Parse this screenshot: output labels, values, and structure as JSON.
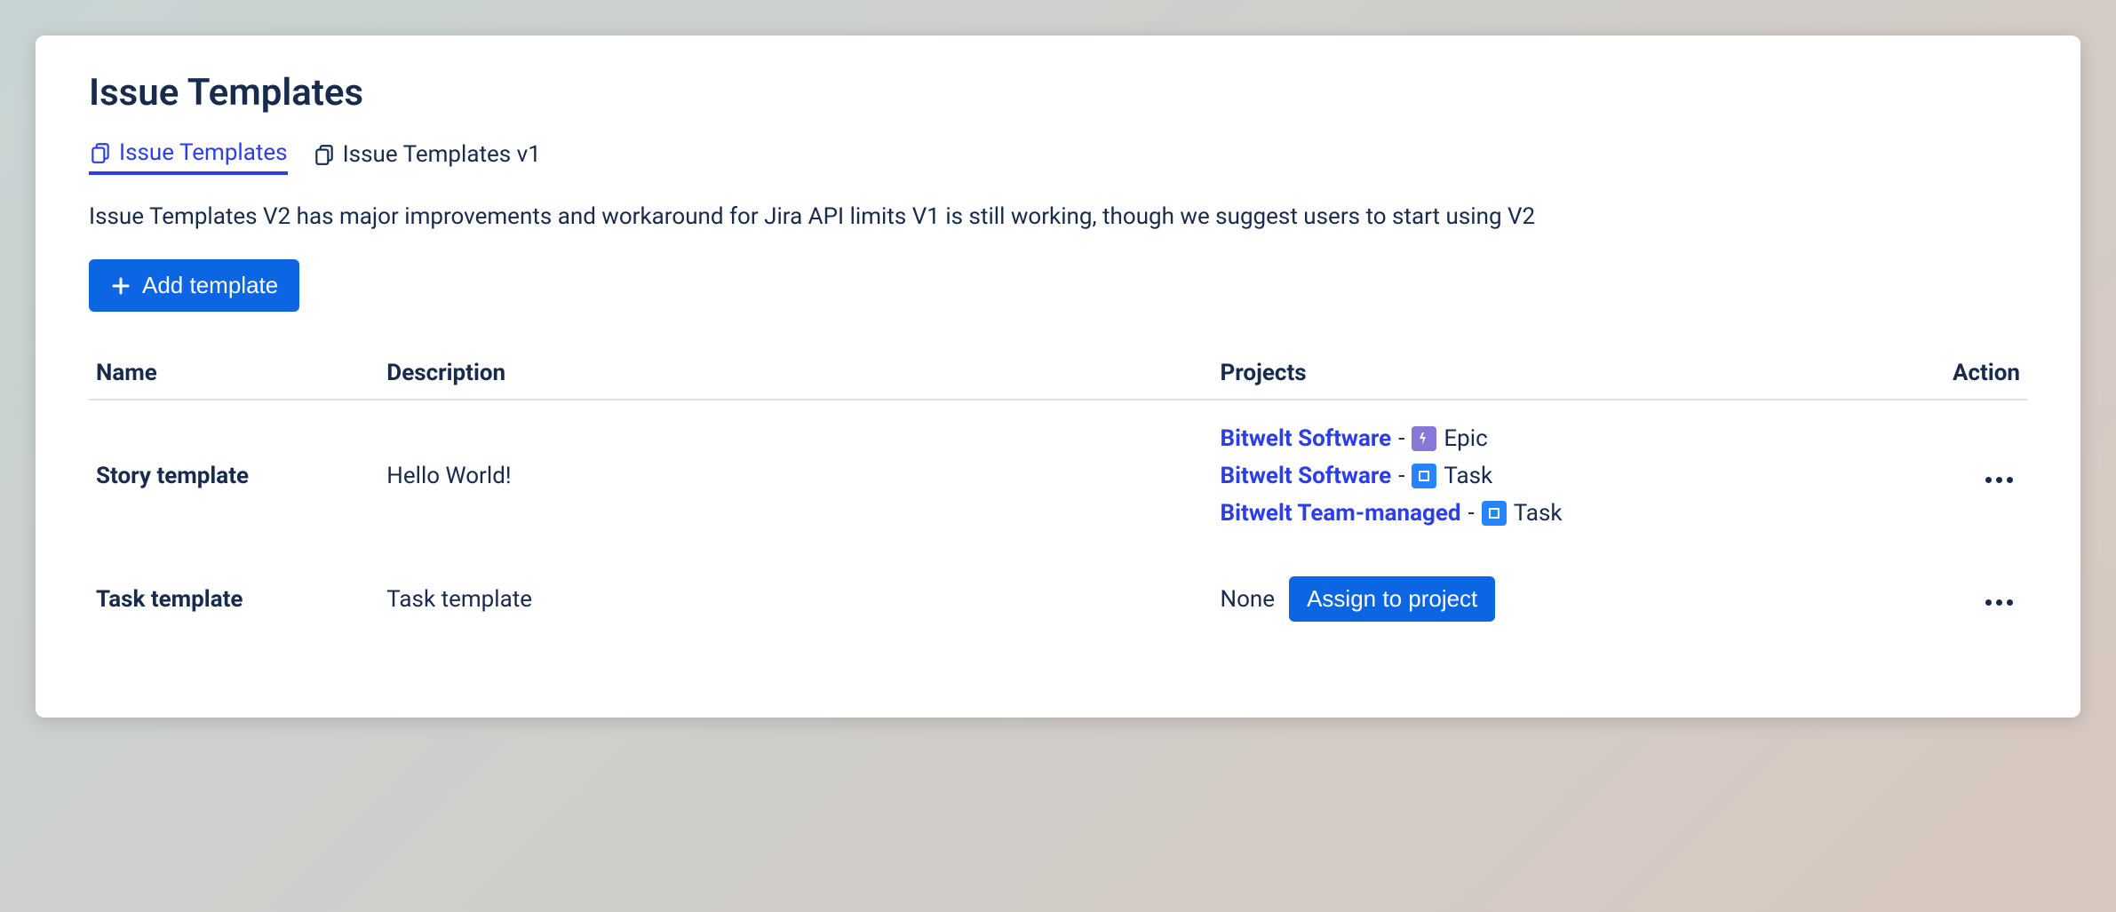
{
  "page": {
    "title": "Issue Templates",
    "description": "Issue Templates V2 has major improvements and workaround for Jira API limits V1 is still working, though we suggest users to start using V2",
    "add_button": "Add template",
    "assign_button": "Assign to project"
  },
  "tabs": [
    {
      "label": "Issue Templates",
      "active": true
    },
    {
      "label": "Issue Templates v1",
      "active": false
    }
  ],
  "columns": {
    "name": "Name",
    "description": "Description",
    "projects": "Projects",
    "action": "Action"
  },
  "rows": [
    {
      "name": "Story template",
      "description": "Hello World!",
      "projects": [
        {
          "project": "Bitwelt Software",
          "type": "Epic",
          "type_kind": "epic"
        },
        {
          "project": "Bitwelt Software",
          "type": "Task",
          "type_kind": "task"
        },
        {
          "project": "Bitwelt Team-managed",
          "type": "Task",
          "type_kind": "task"
        }
      ]
    },
    {
      "name": "Task template",
      "description": "Task template",
      "projects_none": "None"
    }
  ]
}
